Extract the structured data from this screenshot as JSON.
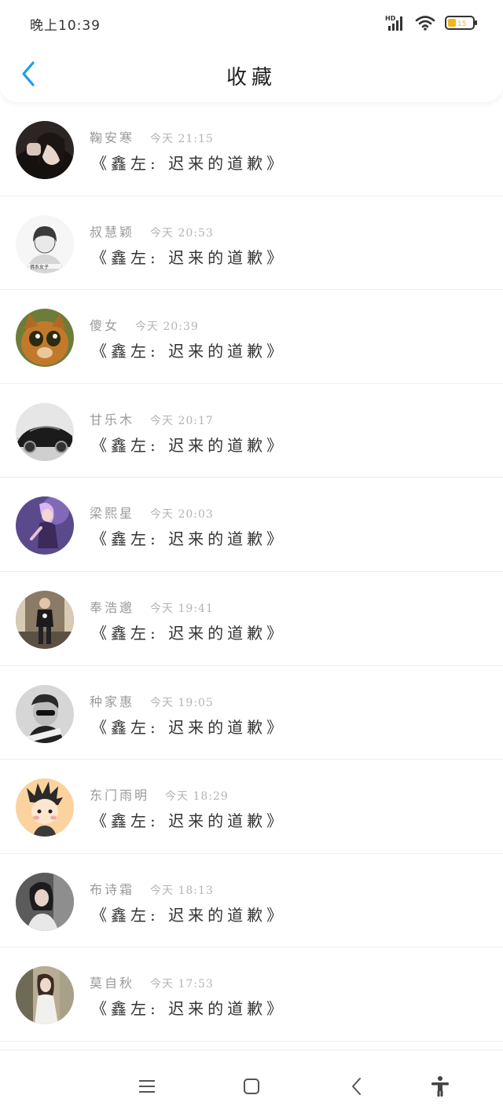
{
  "status_bar": {
    "time": "晚上10:39",
    "network": "HD",
    "icons": [
      "signal-icon",
      "wifi-icon",
      "battery-icon"
    ],
    "battery_level": 0.15
  },
  "header": {
    "title": "收藏",
    "back_icon": "chevron-left-icon",
    "accent_color": "#1f9bf0"
  },
  "favorites": [
    {
      "name": "鞠安寒",
      "time": "今天 21:15",
      "post": "《鑫左: 迟来的道歉》",
      "avatar": "avatar-girl-dark"
    },
    {
      "name": "叔慧颖",
      "time": "今天 20:53",
      "post": "《鑫左: 迟来的道歉》",
      "avatar": "avatar-sketch-girl"
    },
    {
      "name": "傻女",
      "time": "今天 20:39",
      "post": "《鑫左: 迟来的道歉》",
      "avatar": "avatar-cat"
    },
    {
      "name": "甘乐木",
      "time": "今天 20:17",
      "post": "《鑫左: 迟来的道歉》",
      "avatar": "avatar-car"
    },
    {
      "name": "梁熙星",
      "time": "今天 20:03",
      "post": "《鑫左: 迟来的道歉》",
      "avatar": "avatar-game-character"
    },
    {
      "name": "奉浩邈",
      "time": "今天 19:41",
      "post": "《鑫左: 迟来的道歉》",
      "avatar": "avatar-man-street"
    },
    {
      "name": "种家惠",
      "time": "今天 19:05",
      "post": "《鑫左: 迟来的道歉》",
      "avatar": "avatar-man-bw"
    },
    {
      "name": "东门雨明",
      "time": "今天 18:29",
      "post": "《鑫左: 迟来的道歉》",
      "avatar": "avatar-cartoon-boy"
    },
    {
      "name": "布诗霜",
      "time": "今天 18:13",
      "post": "《鑫左: 迟来的道歉》",
      "avatar": "avatar-girl-portrait"
    },
    {
      "name": "莫自秋",
      "time": "今天 17:53",
      "post": "《鑫左: 迟来的道歉》",
      "avatar": "avatar-girl-outdoor"
    }
  ],
  "bottom_nav": {
    "items": [
      "menu-icon",
      "home-square-icon",
      "back-chevron-icon",
      "accessibility-icon"
    ]
  }
}
